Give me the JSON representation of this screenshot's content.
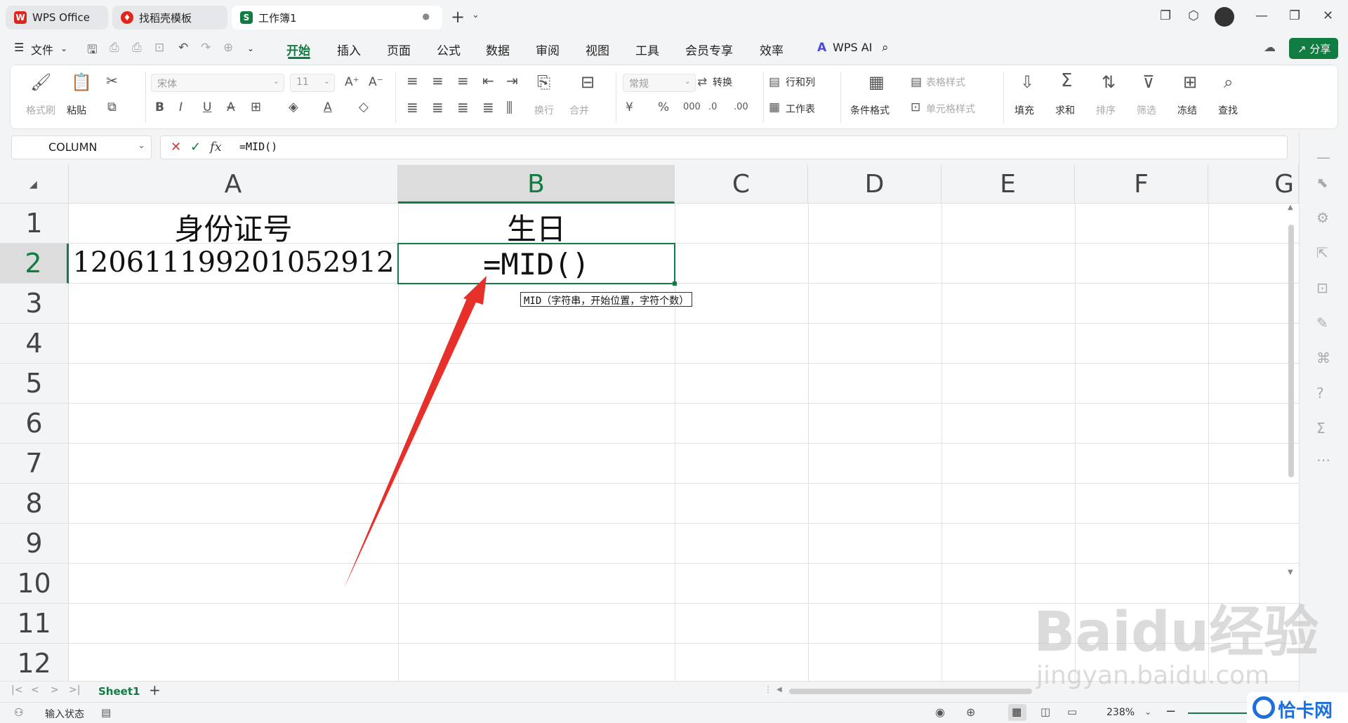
{
  "tabs": [
    {
      "label": "WPS Office"
    },
    {
      "label": "找稻壳模板"
    },
    {
      "label": "工作簿1"
    }
  ],
  "menu": {
    "file": "文件",
    "items": [
      "开始",
      "插入",
      "页面",
      "公式",
      "数据",
      "审阅",
      "视图",
      "工具",
      "会员专享",
      "效率"
    ],
    "ai": "WPS AI",
    "share": "分享"
  },
  "ribbon": {
    "format_painter": "格式刷",
    "paste": "粘贴",
    "font_name": "宋体",
    "font_size": "11",
    "number_format": "常规",
    "convert": "转换",
    "rows_cols": "行和列",
    "worksheet": "工作表",
    "wrap": "换行",
    "merge": "合并",
    "cond_format": "条件格式",
    "table_style": "表格样式",
    "cell_style": "单元格样式",
    "fill": "填充",
    "sum": "求和",
    "sort": "排序",
    "filter": "筛选",
    "freeze": "冻结",
    "find": "查找"
  },
  "formula_bar": {
    "name_box": "COLUMN",
    "formula": "=MID()"
  },
  "grid": {
    "columns": [
      "A",
      "B",
      "C",
      "D",
      "E",
      "F",
      "G"
    ],
    "rows": [
      "1",
      "2",
      "3",
      "4",
      "5",
      "6",
      "7",
      "8",
      "9",
      "10",
      "11",
      "12"
    ],
    "a1": "身份证号",
    "b1": "生日",
    "a2": "120611199201052912",
    "b2": "=MID()",
    "tooltip_fn": "MID",
    "tooltip_args": "（字符串，开始位置，字符个数）"
  },
  "sheet_tab": "Sheet1",
  "status": {
    "mode": "输入状态",
    "zoom": "238%"
  },
  "watermark": {
    "brand": "Baidu经验",
    "url": "jingyan.baidu.com",
    "corner": "恰卡网"
  },
  "colors": {
    "accent": "#107c41",
    "arrow": "#e8302a"
  }
}
